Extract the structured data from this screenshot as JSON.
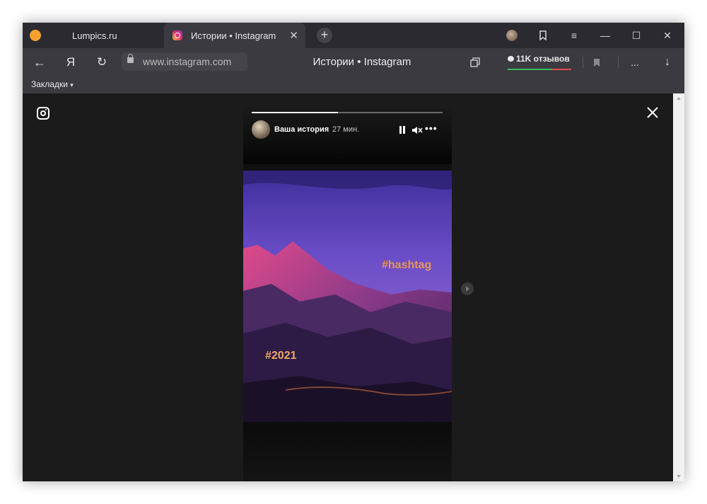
{
  "tabs": [
    {
      "title": "Lumpics.ru"
    },
    {
      "title": "Истории • Instagram"
    }
  ],
  "titlebar": {
    "new_tab": "+",
    "close_tab": "✕",
    "menu": "≡",
    "minimize": "—",
    "maximize": "☐",
    "close": "✕"
  },
  "navbar": {
    "back": "←",
    "home": "Я",
    "reload": "↻",
    "url": "www.instagram.com",
    "page_title": "Истории • Instagram",
    "reviews": "11K отзывов",
    "more": "...",
    "download": "↓"
  },
  "bookmarks": {
    "label": "Закладки",
    "caret": "▾"
  },
  "story": {
    "username": "Ваша история",
    "time": "27 мин.",
    "more": "•••",
    "progress": 0.45,
    "hashtags": [
      "#hashtag",
      "#2021"
    ]
  },
  "colors": {
    "ig_accent": "#e1306c",
    "hashtag": "#e8955a",
    "background": "#1b1b1b"
  }
}
